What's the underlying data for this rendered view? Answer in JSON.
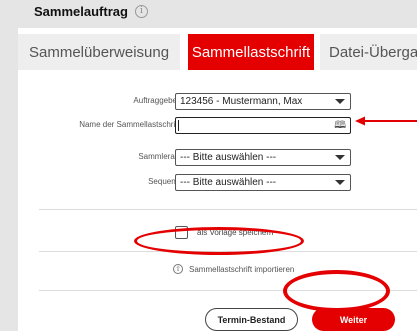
{
  "header": {
    "title": "Sammelauftrag",
    "info_symbol": "i"
  },
  "tabs": [
    {
      "label": "Sammelüberweisung",
      "active": false
    },
    {
      "label": "Sammellastschrift",
      "active": true
    },
    {
      "label": "Datei-Übergabe",
      "active": false
    }
  ],
  "form": {
    "auftraggeber": {
      "label": "Auftraggeber*:",
      "value": "123456 - Mustermann, Max"
    },
    "name": {
      "label": "Name der Sammellastschrift*:",
      "value": ""
    },
    "sammelart": {
      "label": "Sammlerart*:",
      "value": "--- Bitte auswählen ---"
    },
    "sequenz": {
      "label": "Sequenz*:",
      "value": "--- Bitte auswählen ---"
    }
  },
  "checkbox": {
    "label": "als Vorlage speichern",
    "checked": false
  },
  "import": {
    "label": "Sammellastschrift importieren"
  },
  "buttons": {
    "termin": "Termin-Bestand",
    "weiter": "Weiter"
  },
  "colors": {
    "accent": "#e40000",
    "background": "#e5e5e5",
    "panel": "#ffffff"
  },
  "icons": {
    "info": "info-icon",
    "address_book": "address-book-icon",
    "dropdown": "chevron-down-icon",
    "upload": "upload-icon"
  }
}
